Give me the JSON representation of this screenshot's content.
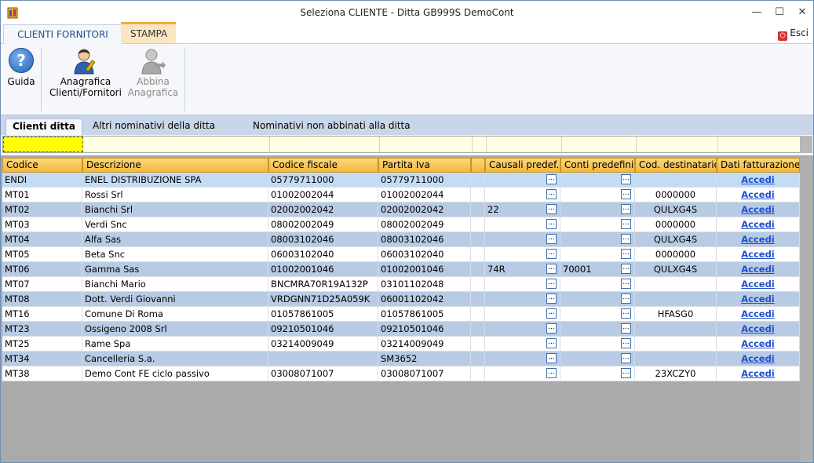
{
  "window": {
    "title": "Seleziona CLIENTE  - Ditta GB999S DemoCont",
    "minimize_glyph": "—",
    "maximize_glyph": "☐",
    "close_glyph": "✕"
  },
  "ribbon_tabs": [
    {
      "label": "CLIENTI FORNITORI",
      "active": true
    },
    {
      "label": "STAMPA",
      "active": false
    }
  ],
  "esci": {
    "label": "Esci",
    "icon": "exit-icon",
    "color": "#d93030"
  },
  "ribbon_buttons": {
    "guida": {
      "label": "Guida",
      "icon": "help-icon"
    },
    "anagrafica": {
      "label_line1": "Anagrafica",
      "label_line2": "Clienti/Fornitori",
      "icon": "user-edit-icon"
    },
    "abbina": {
      "label_line1": "Abbina",
      "label_line2": "Anagrafica",
      "icon": "user-link-icon",
      "enabled": false
    }
  },
  "sub_tabs": [
    {
      "label": "Clienti ditta",
      "active": true
    },
    {
      "label": "Altri nominativi della ditta",
      "active": false
    },
    {
      "label": "Nominativi non abbinati alla ditta",
      "active": false
    }
  ],
  "columns": [
    "Codice",
    "Descrizione",
    "Codice fiscale",
    "Partita Iva",
    "",
    "Causali predef.",
    "Conti predefiniti",
    "Cod. destinatario",
    "Dati fatturazione"
  ],
  "ellipsis_label": "...",
  "link_label": "Accedi",
  "rows": [
    {
      "codice": "ENDI",
      "descrizione": "ENEL DISTRIBUZIONE SPA",
      "cf": "05779711000",
      "piva": "05779711000",
      "causali": "",
      "conti": "",
      "dest": "",
      "selected": true
    },
    {
      "codice": "MT01",
      "descrizione": "Rossi Srl",
      "cf": "01002002044",
      "piva": "01002002044",
      "causali": "",
      "conti": "",
      "dest": "0000000"
    },
    {
      "codice": "MT02",
      "descrizione": "Bianchi Srl",
      "cf": "02002002042",
      "piva": "02002002042",
      "causali": "22",
      "conti": "",
      "dest": "QULXG4S"
    },
    {
      "codice": "MT03",
      "descrizione": "Verdi Snc",
      "cf": "08002002049",
      "piva": "08002002049",
      "causali": "",
      "conti": "",
      "dest": "0000000"
    },
    {
      "codice": "MT04",
      "descrizione": "Alfa Sas",
      "cf": "08003102046",
      "piva": "08003102046",
      "causali": "",
      "conti": "",
      "dest": "QULXG4S"
    },
    {
      "codice": "MT05",
      "descrizione": "Beta Snc",
      "cf": "06003102040",
      "piva": "06003102040",
      "causali": "",
      "conti": "",
      "dest": "0000000"
    },
    {
      "codice": "MT06",
      "descrizione": "Gamma Sas",
      "cf": "01002001046",
      "piva": "01002001046",
      "causali": "74R",
      "conti": "70001",
      "dest": "QULXG4S"
    },
    {
      "codice": "MT07",
      "descrizione": "Bianchi Mario",
      "cf": "BNCMRA70R19A132P",
      "piva": "03101102048",
      "causali": "",
      "conti": "",
      "dest": ""
    },
    {
      "codice": "MT08",
      "descrizione": "Dott. Verdi Giovanni",
      "cf": "VRDGNN71D25A059K",
      "piva": "06001102042",
      "causali": "",
      "conti": "",
      "dest": ""
    },
    {
      "codice": "MT16",
      "descrizione": "Comune Di Roma",
      "cf": "01057861005",
      "piva": "01057861005",
      "causali": "",
      "conti": "",
      "dest": "HFASG0"
    },
    {
      "codice": "MT23",
      "descrizione": "Ossigeno 2008 Srl",
      "cf": "09210501046",
      "piva": "09210501046",
      "causali": "",
      "conti": "",
      "dest": ""
    },
    {
      "codice": "MT25",
      "descrizione": "Rame Spa",
      "cf": "03214009049",
      "piva": "03214009049",
      "causali": "",
      "conti": "",
      "dest": ""
    },
    {
      "codice": "MT34",
      "descrizione": "Cancelleria S.a.",
      "cf": "",
      "piva": "SM3652",
      "causali": "",
      "conti": "",
      "dest": ""
    },
    {
      "codice": "MT38",
      "descrizione": "Demo Cont FE ciclo passivo",
      "cf": "03008071007",
      "piva": "03008071007",
      "causali": "",
      "conti": "",
      "dest": "23XCZY0"
    }
  ],
  "colors": {
    "header_gold": "#f3b73b",
    "row_alt": "#b8cbe4",
    "row_selected": "#c4dcf3",
    "filter_bg": "#ffffe1",
    "filter_active": "#ffff00",
    "link": "#1f4fcf"
  }
}
